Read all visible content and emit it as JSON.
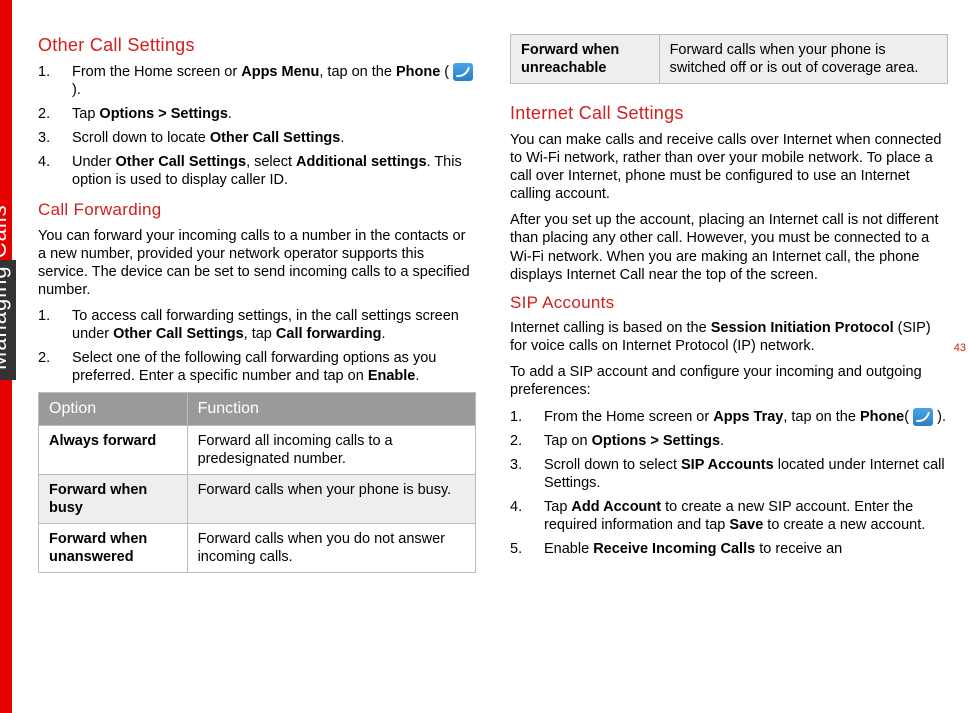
{
  "sidebar_label": "Managing Calls",
  "page_number": "43",
  "left": {
    "h1": "Other Call Settings",
    "steps1": [
      {
        "n": "1.",
        "pre": "From the Home screen or ",
        "b1": "Apps Menu",
        "mid": ", tap on the ",
        "b2": "Phone",
        "post": " ( ",
        "icon": true,
        "tail": " )."
      },
      {
        "n": "2.",
        "pre": "Tap ",
        "b1": "Options > Settings",
        "post": "."
      },
      {
        "n": "3.",
        "pre": "Scroll down to locate ",
        "b1": "Other Call Settings",
        "post": "."
      },
      {
        "n": "4.",
        "pre": "Under ",
        "b1": "Other Call Settings",
        "mid": ", select ",
        "b2": "Additional settings",
        "post": ". This option is used to display caller ID."
      }
    ],
    "h2": "Call Forwarding",
    "p1": "You can forward your incoming calls to a number in the contacts or a new number, provided your network operator supports this service. The device can be set to send incoming calls to a specified number.",
    "steps2": [
      {
        "n": "1.",
        "pre": "To access call forwarding  settings, in the call settings screen under ",
        "b1": "Other Call Settings",
        "mid": ", tap ",
        "b2": "Call forwarding",
        "post": "."
      },
      {
        "n": "2.",
        "pre": "Select one of the following call forwarding options as you preferred. Enter a specific number and tap on ",
        "b1": "Enable",
        "post": "."
      }
    ],
    "table": {
      "head_option": "Option",
      "head_function": "Function",
      "rows": [
        {
          "opt": "Always forward",
          "fn": "Forward all incoming calls to a predesignated number.",
          "shade": false
        },
        {
          "opt": "Forward when busy",
          "fn": "Forward calls when your phone is busy.",
          "shade": true
        },
        {
          "opt": "Forward when unanswered",
          "fn": "Forward calls when you do not answer incoming calls.",
          "shade": false
        }
      ]
    }
  },
  "right": {
    "top_table": {
      "opt": "Forward when unreachable",
      "fn": "Forward calls when your phone is switched off or is out of coverage area."
    },
    "h1": "Internet Call Settings",
    "p1": "You can make calls and receive calls over Internet when connected to Wi-Fi network, rather than over your mobile network. To place a call over Internet, phone must be configured to use an Internet calling account.",
    "p2": "After you set up the account, placing an Internet call is not different than placing any other call. However, you must be connected to a Wi-Fi network. When you are making an Internet call, the phone displays Internet Call near the top of the screen.",
    "h2": "SIP Accounts",
    "p3_pre": "Internet calling is based on the ",
    "p3_b": "Session Initiation Protocol",
    "p3_post": " (SIP) for voice calls on Internet Protocol (IP) network.",
    "p4": "To add a SIP account and configure your incoming and outgoing preferences:",
    "steps": [
      {
        "n": "1.",
        "pre": "From the Home screen or ",
        "b1": "Apps Tray",
        "mid": ", tap on the ",
        "b2": "Phone",
        "post": "( ",
        "icon": true,
        "tail": " )."
      },
      {
        "n": "2.",
        "pre": "Tap on ",
        "b1": "Options > Settings",
        "post": "."
      },
      {
        "n": "3.",
        "pre": "Scroll down to select ",
        "b1": "SIP Accounts",
        "post": " located under Internet call Settings."
      },
      {
        "n": "4.",
        "pre": "Tap ",
        "b1": "Add Account",
        "mid": " to create a new SIP account. Enter the required information and tap ",
        "b2": "Save",
        "post": " to create a new account."
      },
      {
        "n": "5.",
        "pre": "Enable ",
        "b1": "Receive Incoming Calls",
        "post": " to receive an"
      }
    ]
  }
}
